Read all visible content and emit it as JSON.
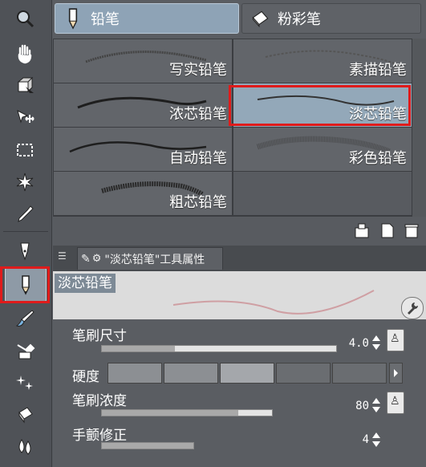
{
  "toolbar": {
    "tools": [
      {
        "icon": "zoom-icon"
      },
      {
        "icon": "hand-icon"
      },
      {
        "icon": "object-operation-icon"
      },
      {
        "icon": "move-layer-icon"
      },
      {
        "icon": "selection-icon"
      },
      {
        "icon": "auto-select-icon"
      },
      {
        "icon": "eyedropper-icon"
      },
      {
        "icon": "pen-icon"
      },
      {
        "icon": "pencil-icon",
        "active": true
      },
      {
        "icon": "brush-icon"
      },
      {
        "icon": "airbrush-icon"
      },
      {
        "icon": "decoration-icon"
      },
      {
        "icon": "eraser-icon"
      },
      {
        "icon": "blend-icon"
      }
    ]
  },
  "tabs": [
    {
      "label": "铅笔",
      "icon": "pencil-icon",
      "active": true
    },
    {
      "label": "粉彩笔",
      "icon": "eraser-icon",
      "active": false
    }
  ],
  "brushes": [
    {
      "name": "写实铅笔"
    },
    {
      "name": "素描铅笔"
    },
    {
      "name": "浓芯铅笔"
    },
    {
      "name": "淡芯铅笔",
      "selected": true
    },
    {
      "name": "自动铅笔"
    },
    {
      "name": "彩色铅笔"
    },
    {
      "name": "粗芯铅笔"
    }
  ],
  "footer_icons": [
    "new-brush-icon",
    "copy-icon",
    "delete-icon"
  ],
  "property_panel": {
    "tab_title": "\"淡芯铅笔\"工具属性",
    "preview_name": "淡芯铅笔",
    "brush_size": {
      "label": "笔刷尺寸",
      "value": "4.0",
      "fill": 0.31
    },
    "hardness": {
      "label": "硬度",
      "segments": 5,
      "selected": 2
    },
    "brush_density": {
      "label": "笔刷浓度",
      "value": "80",
      "fill": 0.8
    },
    "stabilization": {
      "label": "手颤修正",
      "value": "4",
      "fill": 0.36
    }
  },
  "colors": {
    "highlight": "#e01b1b",
    "selected_bg": "#93a8b9"
  }
}
